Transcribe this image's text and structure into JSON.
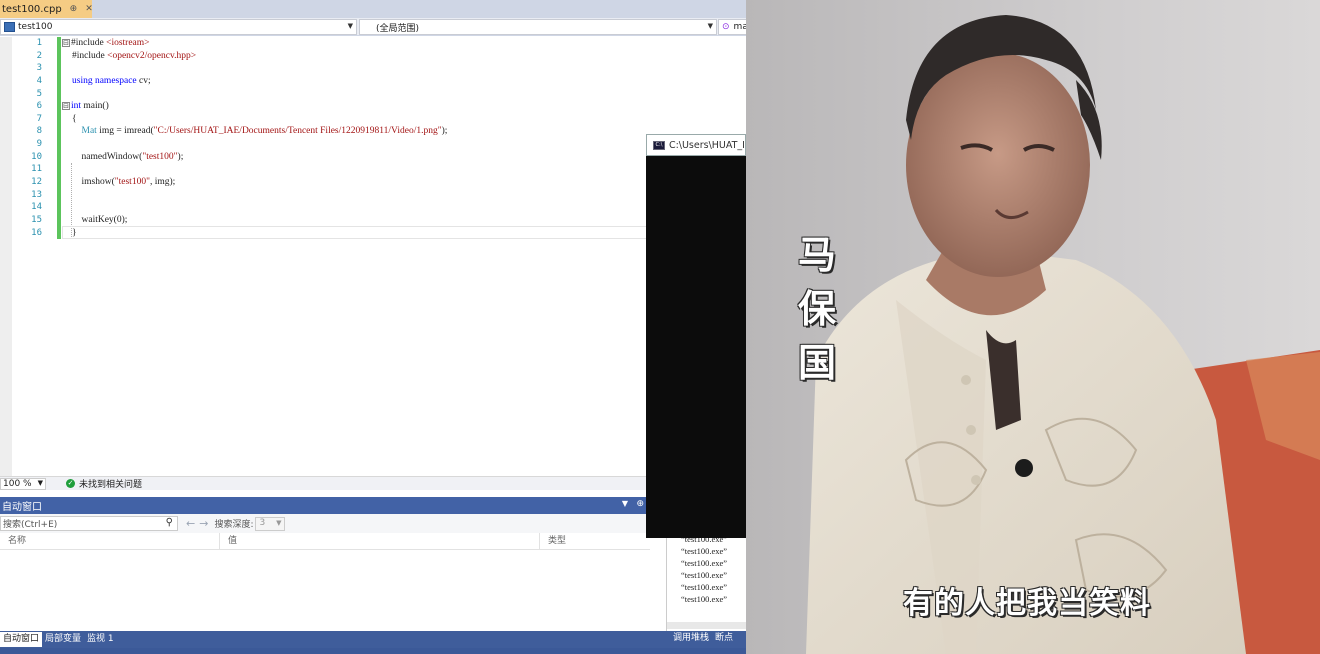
{
  "ide": {
    "tab": {
      "filename": "test100.cpp",
      "pin": "⊕",
      "close": "✕"
    },
    "navbar": {
      "project": "test100",
      "scope": "(全局范围)",
      "member": "ma"
    },
    "line_numbers": [
      "1",
      "2",
      "3",
      "4",
      "5",
      "6",
      "7",
      "8",
      "9",
      "10",
      "11",
      "12",
      "13",
      "14",
      "15",
      "16"
    ],
    "code": [
      {
        "fold": "⊟",
        "parts": [
          [
            "pp",
            "#include "
          ],
          [
            "str",
            "<iostream>"
          ]
        ]
      },
      {
        "fold": "",
        "parts": [
          [
            "pp",
            "#include "
          ],
          [
            "str",
            "<opencv2/opencv.hpp>"
          ]
        ]
      },
      {
        "fold": "",
        "parts": []
      },
      {
        "fold": "",
        "parts": [
          [
            "kw",
            "using namespace"
          ],
          [
            "pp",
            " cv;"
          ]
        ]
      },
      {
        "fold": "",
        "parts": []
      },
      {
        "fold": "⊟",
        "parts": [
          [
            "kw",
            "int"
          ],
          [
            "pp",
            " main()"
          ]
        ]
      },
      {
        "fold": "",
        "parts": [
          [
            "pp",
            "{"
          ]
        ]
      },
      {
        "fold": "",
        "parts": [
          [
            "type",
            "    Mat"
          ],
          [
            "pp",
            " img = imread("
          ],
          [
            "str",
            "\"C:/Users/HUAT_IAE/Documents/Tencent Files/1220919811/Video/1.png\""
          ],
          [
            "pp",
            ");"
          ]
        ]
      },
      {
        "fold": "",
        "parts": []
      },
      {
        "fold": "",
        "parts": [
          [
            "pp",
            "    namedWindow("
          ],
          [
            "str",
            "\"test100\""
          ],
          [
            "pp",
            ");"
          ]
        ]
      },
      {
        "fold": "",
        "parts": []
      },
      {
        "fold": "",
        "parts": [
          [
            "pp",
            "    imshow("
          ],
          [
            "str",
            "\"test100\""
          ],
          [
            "pp",
            ", img);"
          ]
        ]
      },
      {
        "fold": "",
        "parts": []
      },
      {
        "fold": "",
        "parts": []
      },
      {
        "fold": "",
        "parts": [
          [
            "pp",
            "    waitKey(0);"
          ]
        ]
      },
      {
        "fold": "",
        "parts": [
          [
            "pp",
            "}"
          ]
        ]
      }
    ],
    "status": {
      "zoom": "100 %",
      "issues": "未找到相关问题"
    },
    "autos": {
      "title": "自动窗口",
      "search_placeholder": "搜索(Ctrl+E)",
      "depth_label": "搜索深度:",
      "depth_value": "3",
      "columns": [
        "名称",
        "值",
        "类型"
      ]
    },
    "output_lines": [
      "“test100.exe”",
      "“test100.exe”",
      "“test100.exe”",
      "“test100.exe”",
      "“test100.exe”",
      "“test100.exe”"
    ],
    "bottom_tabs": [
      "自动窗口",
      "局部变量",
      "监视 1"
    ],
    "bottom_tabs_right": [
      "调用堆栈",
      "断点"
    ],
    "console_title": "C:\\Users\\HUAT_I"
  },
  "photo": {
    "name_chars": [
      "马",
      "保",
      "国"
    ],
    "subtitle": "有的人把我当笑料"
  },
  "colors": {
    "tab_active": "#f5cc84",
    "tool_title": "#4262a6",
    "change_bar": "#5cc45c",
    "keyword": "#0000ff",
    "string": "#a31515"
  }
}
